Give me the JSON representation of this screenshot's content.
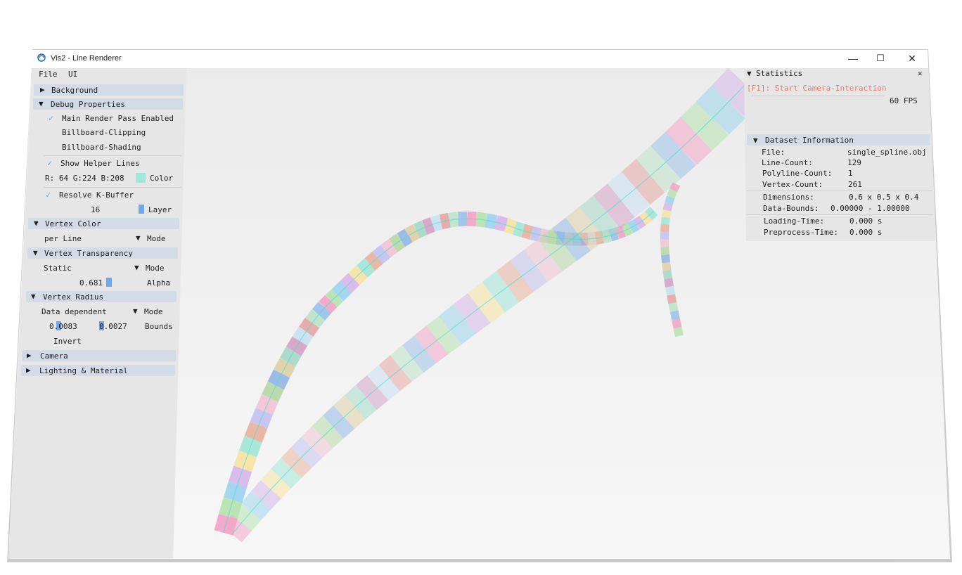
{
  "window": {
    "title": "Vis2 - Line Renderer",
    "minimize": "—",
    "maximize": "☐",
    "close": "✕"
  },
  "menu": {
    "file": "File",
    "ui": "UI"
  },
  "sidebar": {
    "background": {
      "arrow": "▶",
      "label": "Background"
    },
    "debug": {
      "arrow": "▼",
      "label": "Debug Properties",
      "main_render_pass": "Main Render Pass Enabled",
      "billboard_clipping": "Billboard-Clipping",
      "billboard_shading": "Billboard-Shading",
      "show_helper_lines": "Show Helper Lines",
      "rgb": "R: 64 G:224 B:208",
      "color_label": "Color",
      "color_hex": "#9ee8dc",
      "resolve_kbuffer": "Resolve K-Buffer",
      "layer_value": "16",
      "layer_label": "Layer"
    },
    "vertex_color": {
      "arrow": "▼",
      "label": "Vertex Color",
      "value": "per Line",
      "mode_arrow": "▼",
      "mode_label": "Mode"
    },
    "vertex_transparency": {
      "arrow": "▼",
      "label": "Vertex Transparency",
      "value": "Static",
      "mode_arrow": "▼",
      "mode_label": "Mode",
      "alpha_value": "0.681",
      "alpha_label": "Alpha"
    },
    "vertex_radius": {
      "arrow": "▼",
      "label": "Vertex Radius",
      "value": "Data dependent",
      "mode_arrow": "▼",
      "mode_label": "Mode",
      "bound_min": "0.0083",
      "bound_max": "0.0027",
      "bounds_label": "Bounds",
      "invert": "Invert"
    },
    "camera": {
      "arrow": "▶",
      "label": "Camera"
    },
    "lighting": {
      "arrow": "▶",
      "label": "Lighting & Material"
    }
  },
  "statistics": {
    "arrow": "▼",
    "title": "Statistics",
    "close": "✕",
    "hint": "[F1]: Start Camera-Interaction",
    "fps": "60 FPS",
    "dataset": {
      "arrow": "▼",
      "title": "Dataset Information",
      "file_label": "File:",
      "file_value": "single_spline.obj",
      "line_count_label": "Line-Count:",
      "line_count_value": "129",
      "polyline_count_label": "Polyline-Count:",
      "polyline_count_value": "1",
      "vertex_count_label": "Vertex-Count:",
      "vertex_count_value": "261",
      "dimensions_label": "Dimensions:",
      "dimensions_value": "0.6 x 0.5 x 0.4",
      "bounds_label": "Data-Bounds:",
      "bounds_value": "0.00000 - 1.00000",
      "loading_label": "Loading-Time:",
      "loading_value": "0.000 s",
      "preprocess_label": "Preprocess-Time:",
      "preprocess_value": "0.000 s"
    }
  },
  "colors": {
    "accent": "#6aa9e6",
    "header_bg": "#d3dbe7",
    "hint": "#e8776e",
    "panel_bg": "#e6e6e6"
  },
  "scene": {
    "segment_colors": [
      "#f3a6c8",
      "#b7e3b0",
      "#9fd4ee",
      "#d7b8ea",
      "#f5e3a3",
      "#a3e6d8",
      "#e8b4a0",
      "#c3c3f0",
      "#f0c5d6",
      "#b8d9a8",
      "#95b8e6",
      "#e0d0a8",
      "#a8d8c8",
      "#d6a3c6",
      "#c8e0f0",
      "#e6a8a8",
      "#bde3c9",
      "#9cc3e8"
    ]
  }
}
